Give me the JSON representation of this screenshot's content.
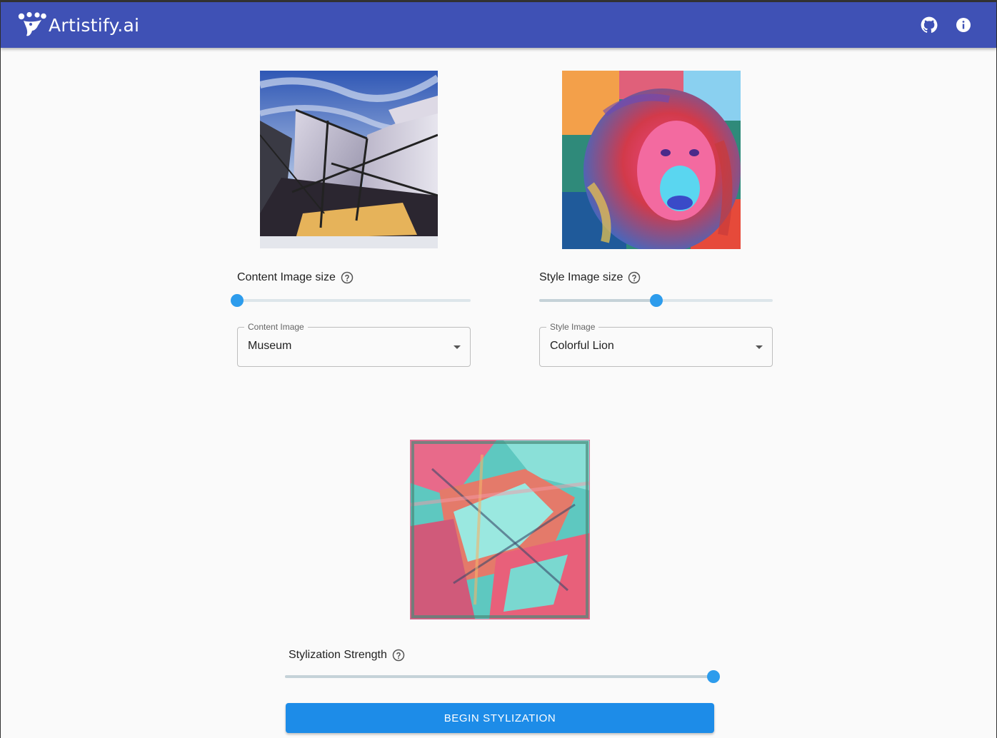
{
  "app": {
    "title": "Artistify.ai"
  },
  "header": {
    "icons": [
      "github-icon",
      "info-icon"
    ]
  },
  "content": {
    "size_label": "Content Image size",
    "size_value": 0.0,
    "select_label": "Content Image",
    "select_value": "Museum"
  },
  "style": {
    "size_label": "Style Image size",
    "size_value": 0.5,
    "select_label": "Style Image",
    "select_value": "Colorful Lion"
  },
  "stylization": {
    "strength_label": "Stylization Strength",
    "strength_value": 1.0,
    "button_label": "BEGIN STYLIZATION"
  },
  "colors": {
    "appbar": "#3f51b5",
    "accent": "#2d9cec",
    "button": "#1d8ce8"
  }
}
